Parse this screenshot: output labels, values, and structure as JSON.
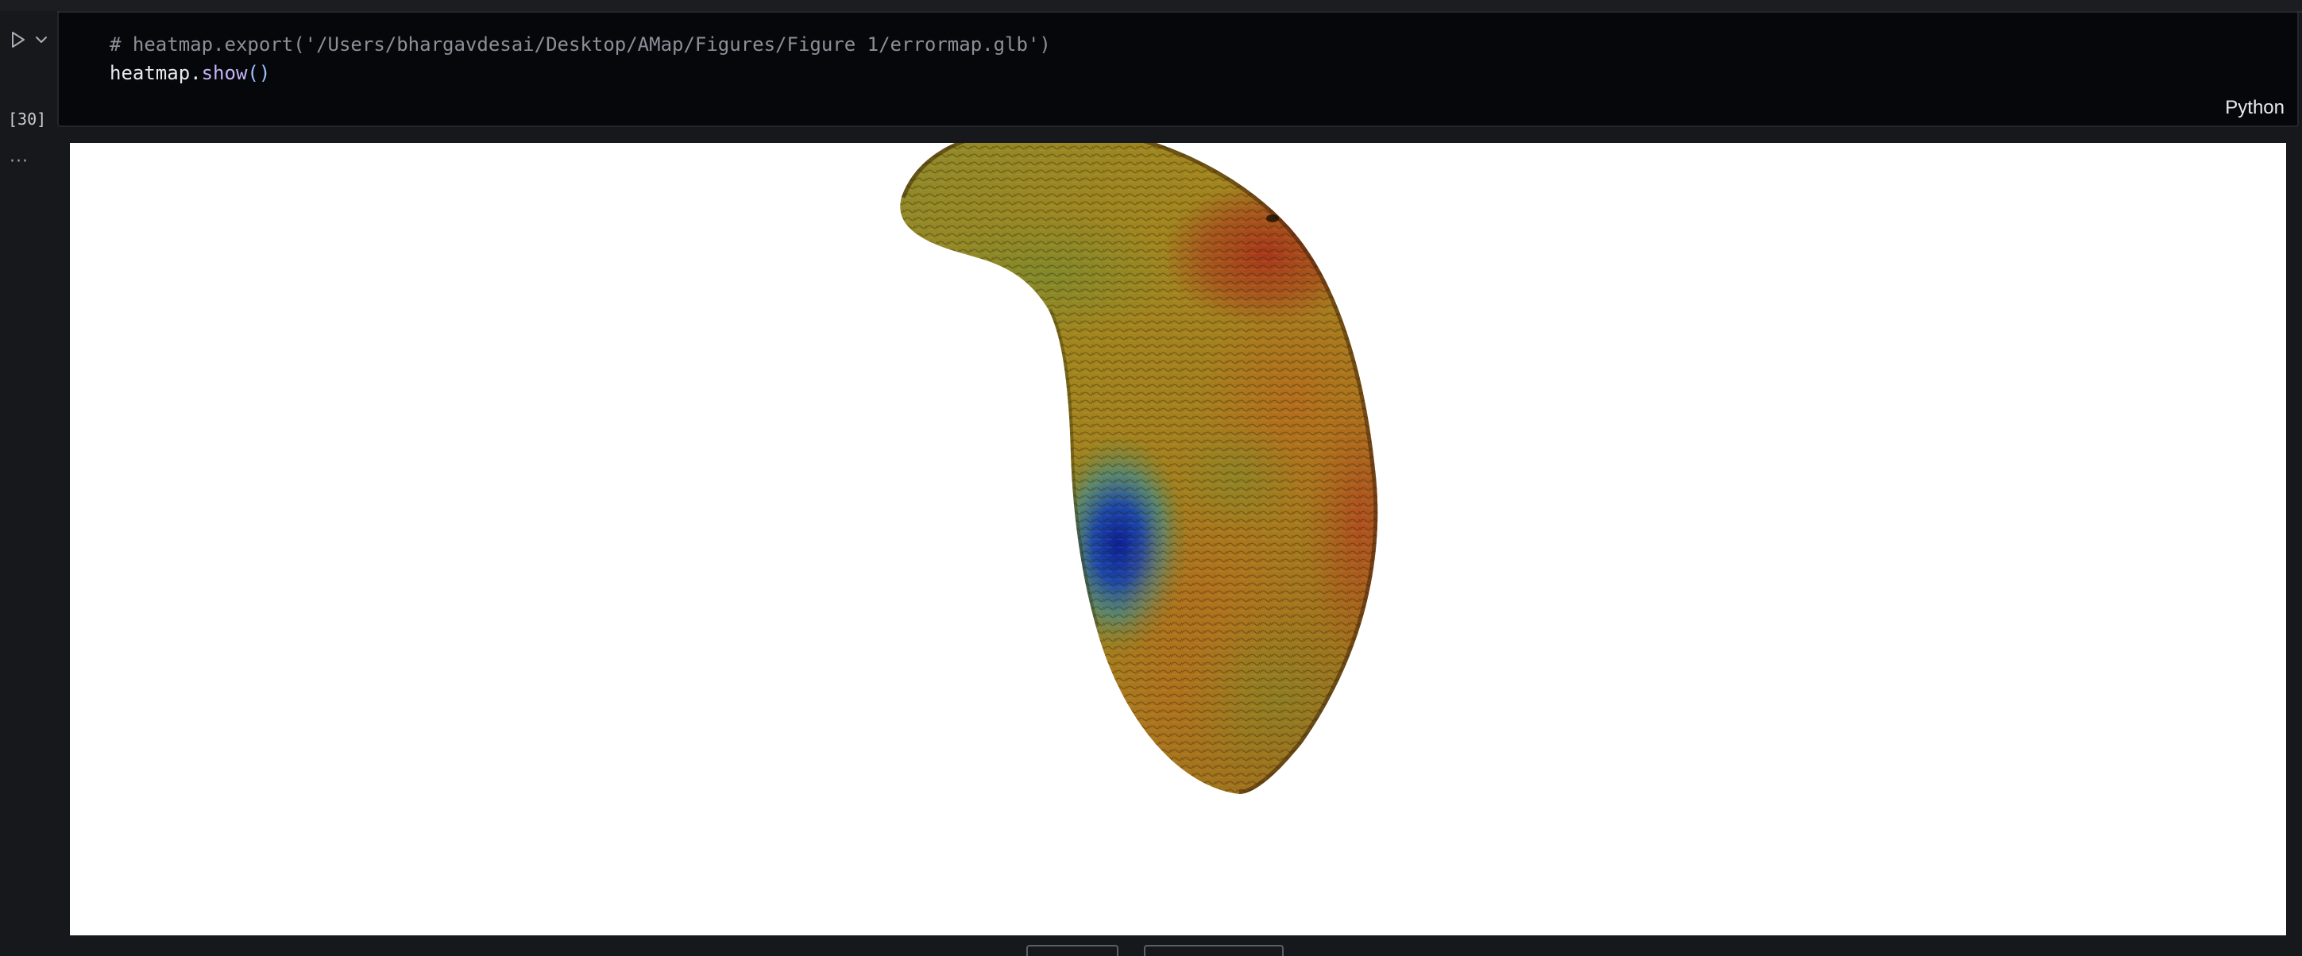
{
  "cell": {
    "execution_count": "[30]",
    "code": {
      "line1": "# heatmap.export('/Users/bhargavdesai/Desktop/AMap/Figures/Figure 1/errormap.glb')",
      "line2_object": "heatmap.",
      "line2_method": "show",
      "line2_parens": "()"
    },
    "language": "Python",
    "output_more": "···"
  },
  "output": {
    "type": "3d-heatmap-render",
    "colormap": [
      "#0b1f9a",
      "#2f6fb0",
      "#6e8a2c",
      "#9b8a22",
      "#b5731c",
      "#a8361a"
    ]
  },
  "icons": {
    "run": "run-triangle-icon",
    "chevron": "chevron-down-icon"
  }
}
